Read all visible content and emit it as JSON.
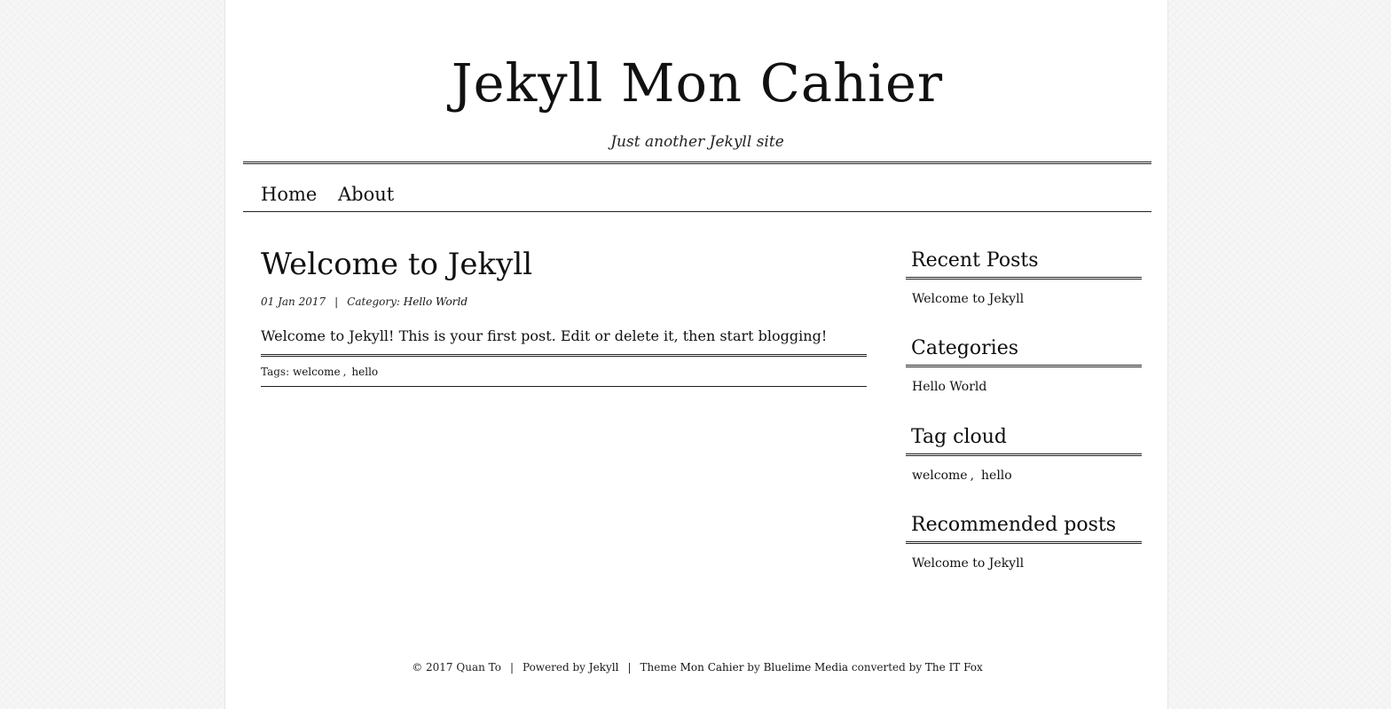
{
  "site": {
    "title": "Jekyll Mon Cahier",
    "tagline": "Just another Jekyll site"
  },
  "nav": {
    "items": [
      {
        "label": "Home"
      },
      {
        "label": "About"
      }
    ]
  },
  "post": {
    "title": "Welcome to Jekyll",
    "date": "01 Jan 2017",
    "separator": "|",
    "category_label": "Category:",
    "category": "Hello World",
    "excerpt": "Welcome to Jekyll! This is your first post. Edit or delete it, then start blogging!",
    "tags_label": "Tags:",
    "tags": [
      "welcome",
      "hello"
    ],
    "tag_separator": ","
  },
  "sidebar": {
    "recent_posts": {
      "title": "Recent Posts",
      "items": [
        "Welcome to Jekyll"
      ]
    },
    "categories": {
      "title": "Categories",
      "items": [
        "Hello World"
      ]
    },
    "tag_cloud": {
      "title": "Tag cloud",
      "items": [
        "welcome",
        "hello"
      ],
      "separator": ","
    },
    "recommended_posts": {
      "title": "Recommended posts",
      "items": [
        "Welcome to Jekyll"
      ]
    }
  },
  "footer": {
    "copyright": "© 2017 Quan To",
    "powered_by_label": "Powered by",
    "powered_by_link": "Jekyll",
    "theme_label": "Theme",
    "theme_link": "Mon Cahier",
    "by_label": "by",
    "theme_author": "Bluelime Media",
    "converted_label": "converted by",
    "converter": "The IT Fox",
    "separator": "|"
  }
}
